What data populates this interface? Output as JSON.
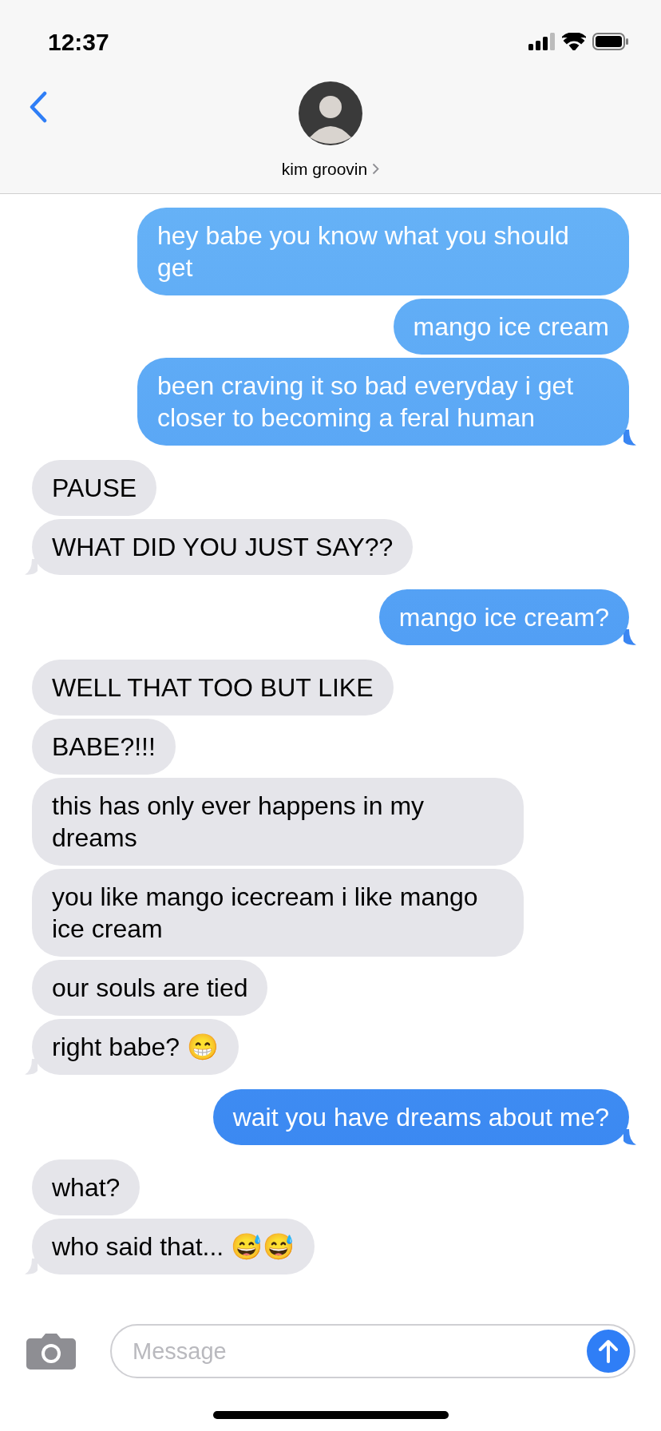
{
  "status_bar": {
    "time": "12:37"
  },
  "header": {
    "contact_name": "kim groovin"
  },
  "messages": [
    {
      "kind": "sent",
      "text": "hey babe you know what you should get",
      "tail": false
    },
    {
      "kind": "sent",
      "text": "mango ice cream",
      "tail": false
    },
    {
      "kind": "sent",
      "text": "been craving it so bad everyday i get closer to becoming a feral human",
      "tail": true
    },
    {
      "kind": "received",
      "text": "PAUSE",
      "tail": false
    },
    {
      "kind": "received",
      "text": "WHAT DID YOU JUST SAY??",
      "tail": true
    },
    {
      "kind": "sent",
      "text": "mango ice cream?",
      "tail": true
    },
    {
      "kind": "received",
      "text": "WELL THAT TOO BUT LIKE",
      "tail": false
    },
    {
      "kind": "received",
      "text": "BABE?!!!",
      "tail": false
    },
    {
      "kind": "received",
      "text": "this has only ever happens in my dreams",
      "tail": false
    },
    {
      "kind": "received",
      "text": "you like mango icecream i like mango ice cream",
      "tail": false
    },
    {
      "kind": "received",
      "text": "our souls are tied",
      "tail": false
    },
    {
      "kind": "received",
      "text": "right babe? 😁",
      "tail": true
    },
    {
      "kind": "sent",
      "text": "wait you have dreams about me?",
      "tail": true
    },
    {
      "kind": "received",
      "text": "what?",
      "tail": false
    },
    {
      "kind": "received",
      "text": "who said that... 😅😅",
      "tail": true
    }
  ],
  "composer": {
    "placeholder": "Message"
  }
}
